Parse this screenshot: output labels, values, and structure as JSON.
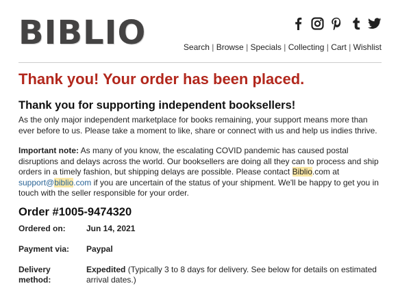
{
  "brand": {
    "logo_text": "BIBLIO"
  },
  "social": [
    {
      "icon": "facebook-icon"
    },
    {
      "icon": "instagram-icon"
    },
    {
      "icon": "pinterest-icon"
    },
    {
      "icon": "tumblr-icon"
    },
    {
      "icon": "twitter-icon"
    }
  ],
  "nav": {
    "items": [
      "Search",
      "Browse",
      "Specials",
      "Collecting",
      "Cart",
      "Wishlist"
    ],
    "separator": "|"
  },
  "main": {
    "headline": "Thank you! Your order has been placed.",
    "subheadline": "Thank you for supporting independent booksellers!",
    "intro": "As the only major independent marketplace for books remaining, your support means more than ever before to us. Please take a moment to like, share or connect with us and help us indies thrive.",
    "note": {
      "label": "Important note:",
      "text_1": " As many of you know, the escalating COVID pandemic has caused postal disruptions and delays across the world. Our booksellers are doing all they can to process and ship orders in a timely fashion, but shipping delays are possible. Please contact ",
      "brand_hl": "Biblio",
      "text_2": ".com at ",
      "email_pre": "support@",
      "email_hl": "biblio",
      "email_post": ".com",
      "text_3": " if you are uncertain of the status of your shipment. We'll be happy to get you in touch with the seller responsible for your order."
    },
    "order": {
      "title": "Order #1005-9474320",
      "ordered_on_label": "Ordered on:",
      "ordered_on_value": "Jun 14, 2021",
      "payment_label": "Payment via:",
      "payment_value": "Paypal",
      "delivery_label_1": "Delivery",
      "delivery_label_2": "method:",
      "delivery_value_bold": "Expedited",
      "delivery_value_rest": " (Typically 3 to 8 days for delivery. See below for details on estimated arrival dates.)"
    }
  },
  "colors": {
    "headline": "#b2271c",
    "highlight": "#fbe8a6",
    "link": "#2a6496",
    "logo": "#444343"
  }
}
